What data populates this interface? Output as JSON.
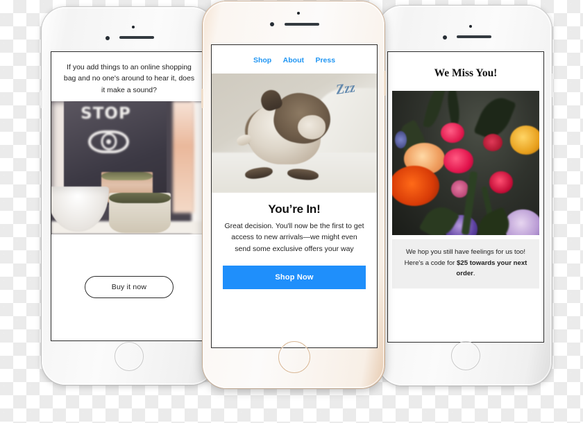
{
  "scene": {
    "title": "Three smartphones showing email campaign mockups",
    "background": "transparent-checkerboard"
  },
  "phones": [
    {
      "id": "left-phone",
      "frame_color": "#f2f2f2",
      "frame_finish": "silver",
      "screen": {
        "headline": "If you add things to an online shopping bag and no one's around to hear it, does it make a sound?",
        "image": {
          "name": "stop-poster-ceramic-bowls-photo",
          "poster_text": "STOP",
          "icon": "eye-icon"
        },
        "cta": {
          "label": "Buy it now",
          "style": "outline-pill"
        }
      }
    },
    {
      "id": "center-phone",
      "frame_color": "#f8f2ea",
      "frame_finish": "rose-gold",
      "screen": {
        "nav": [
          {
            "label": "Shop"
          },
          {
            "label": "About"
          },
          {
            "label": "Press"
          }
        ],
        "nav_color": "#2196f3",
        "image": {
          "name": "sleeping-french-bulldog-photo",
          "overlay_text": "Zzz"
        },
        "title": "You’re In!",
        "body": "Great decision.  You'll now be the first to get access to new arrivals—we might even send some exclusive offers your way",
        "cta": {
          "label": "Shop Now",
          "color": "#1f8ffb",
          "style": "solid-block"
        }
      }
    },
    {
      "id": "right-phone",
      "frame_color": "#f4f4f4",
      "frame_finish": "silver",
      "screen": {
        "title": "We Miss You!",
        "image": {
          "name": "dark-floral-bouquet-photo"
        },
        "note_prefix": "We hop you still have feelings for us too! Here's a code for ",
        "note_bold": "$25 towards your next order",
        "note_suffix": ".",
        "note_background": "#efefef"
      }
    }
  ]
}
